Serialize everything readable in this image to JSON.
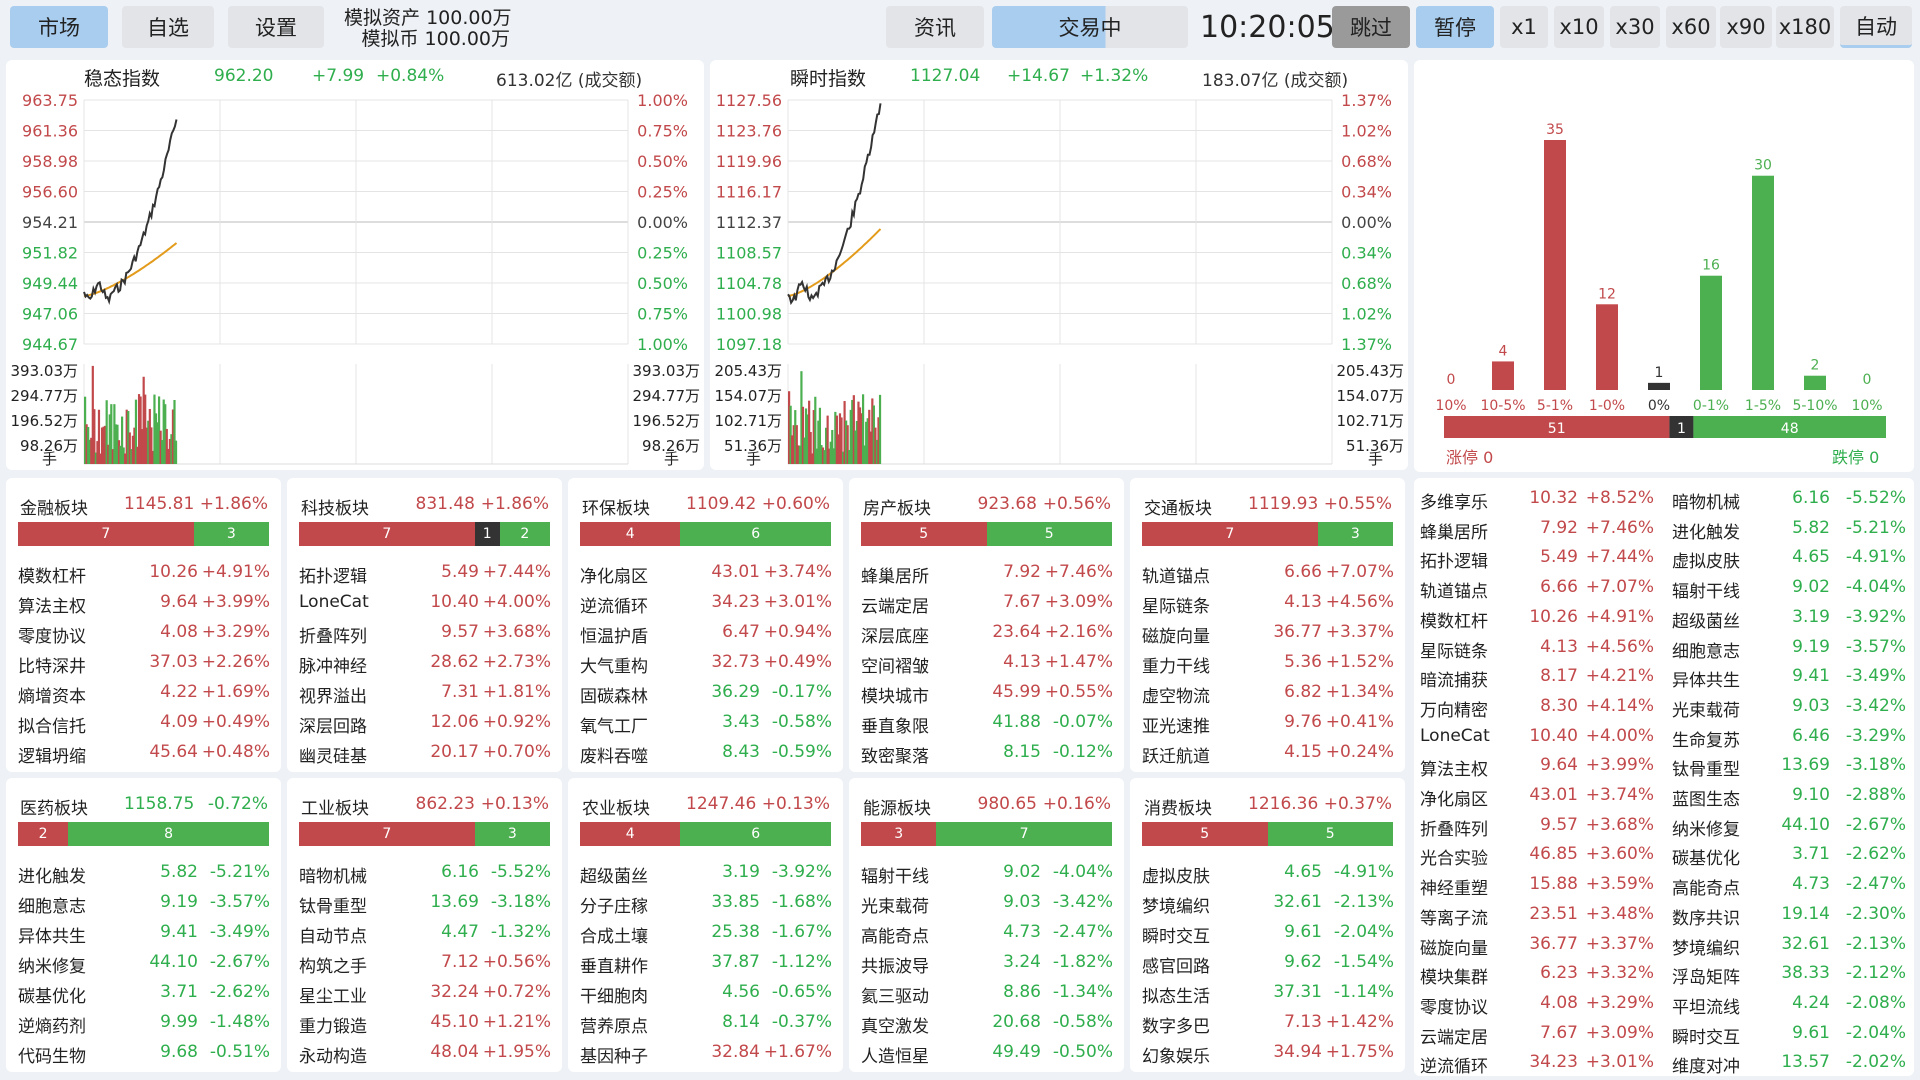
{
  "top": {
    "tabs": [
      {
        "label": "市场",
        "active": true
      },
      {
        "label": "自选"
      },
      {
        "label": "设置"
      }
    ],
    "asset_label": "模拟资产",
    "asset_value": "100.00万",
    "coin_label": "模拟币",
    "coin_value": "100.00万",
    "news": "资讯",
    "status": "交易中",
    "clock": "10:20:05",
    "skip": "跳过",
    "pause": "暂停",
    "speeds": [
      "x1",
      "x10",
      "x30",
      "x60",
      "x90",
      "x180"
    ],
    "auto": "自动"
  },
  "indices": [
    {
      "name": "稳态指数",
      "value": "962.20",
      "change": "+7.99",
      "pct": "+0.84%",
      "amount": "613.02亿 (成交额)",
      "left_ticks": [
        "963.75",
        "961.36",
        "958.98",
        "956.60",
        "954.21",
        "951.82",
        "949.44",
        "947.06",
        "944.67"
      ],
      "right_ticks": [
        "1.00%",
        "0.75%",
        "0.50%",
        "0.25%",
        "0.00%",
        "0.25%",
        "0.50%",
        "0.75%",
        "1.00%"
      ],
      "vol_ticks": [
        "393.03万",
        "294.77万",
        "196.52万",
        "98.26万"
      ],
      "unit": "手"
    },
    {
      "name": "瞬时指数",
      "value": "1127.04",
      "change": "+14.67",
      "pct": "+1.32%",
      "amount": "183.07亿 (成交额)",
      "left_ticks": [
        "1127.56",
        "1123.76",
        "1119.96",
        "1116.17",
        "1112.37",
        "1108.57",
        "1104.78",
        "1100.98",
        "1097.18"
      ],
      "right_ticks": [
        "1.37%",
        "1.02%",
        "0.68%",
        "0.34%",
        "0.00%",
        "0.34%",
        "0.68%",
        "1.02%",
        "1.37%"
      ],
      "vol_ticks": [
        "205.43万",
        "154.07万",
        "102.71万",
        "51.36万"
      ],
      "unit": "手"
    }
  ],
  "chart_data": {
    "type": "bar",
    "categories": [
      "10%",
      "10-5%",
      "5-1%",
      "1-0%",
      "0%",
      "0-1%",
      "1-5%",
      "5-10%",
      "10%"
    ],
    "values": [
      0,
      4,
      35,
      12,
      1,
      16,
      30,
      2,
      0
    ],
    "colors": [
      "#c2494b",
      "#c2494b",
      "#c2494b",
      "#c2494b",
      "#333333",
      "#4caf50",
      "#4caf50",
      "#4caf50",
      "#4caf50"
    ],
    "ratio": {
      "up": 51,
      "flat": 1,
      "down": 48
    },
    "limit_up": "涨停 0",
    "limit_down": "跌停 0"
  },
  "sectors": [
    {
      "name": "金融板块",
      "value": "1145.81",
      "pct": "+1.86%",
      "up": 7,
      "flat": 0,
      "down": 3,
      "stocks": [
        [
          "模数杠杆",
          "10.26",
          "+4.91%"
        ],
        [
          "算法主权",
          "9.64",
          "+3.99%"
        ],
        [
          "零度协议",
          "4.08",
          "+3.29%"
        ],
        [
          "比特深井",
          "37.03",
          "+2.26%"
        ],
        [
          "熵增资本",
          "4.22",
          "+1.69%"
        ],
        [
          "拟合信托",
          "4.09",
          "+0.49%"
        ],
        [
          "逻辑坍缩",
          "45.64",
          "+0.48%"
        ]
      ]
    },
    {
      "name": "科技板块",
      "value": "831.48",
      "pct": "+1.86%",
      "up": 7,
      "flat": 1,
      "down": 2,
      "stocks": [
        [
          "拓扑逻辑",
          "5.49",
          "+7.44%"
        ],
        [
          "LoneCat",
          "10.40",
          "+4.00%"
        ],
        [
          "折叠阵列",
          "9.57",
          "+3.68%"
        ],
        [
          "脉冲神经",
          "28.62",
          "+2.73%"
        ],
        [
          "视界溢出",
          "7.31",
          "+1.81%"
        ],
        [
          "深层回路",
          "12.06",
          "+0.92%"
        ],
        [
          "幽灵硅基",
          "20.17",
          "+0.70%"
        ]
      ]
    },
    {
      "name": "环保板块",
      "value": "1109.42",
      "pct": "+0.60%",
      "up": 4,
      "flat": 0,
      "down": 6,
      "stocks": [
        [
          "净化扇区",
          "43.01",
          "+3.74%"
        ],
        [
          "逆流循环",
          "34.23",
          "+3.01%"
        ],
        [
          "恒温护盾",
          "6.47",
          "+0.94%"
        ],
        [
          "大气重构",
          "32.73",
          "+0.49%"
        ],
        [
          "固碳森林",
          "36.29",
          "-0.17%"
        ],
        [
          "氧气工厂",
          "3.43",
          "-0.58%"
        ],
        [
          "废料吞噬",
          "8.43",
          "-0.59%"
        ]
      ]
    },
    {
      "name": "房产板块",
      "value": "923.68",
      "pct": "+0.56%",
      "up": 5,
      "flat": 0,
      "down": 5,
      "stocks": [
        [
          "蜂巢居所",
          "7.92",
          "+7.46%"
        ],
        [
          "云端定居",
          "7.67",
          "+3.09%"
        ],
        [
          "深层底座",
          "23.64",
          "+2.16%"
        ],
        [
          "空间褶皱",
          "4.13",
          "+1.47%"
        ],
        [
          "模块城市",
          "45.99",
          "+0.55%"
        ],
        [
          "垂直象限",
          "41.88",
          "-0.07%"
        ],
        [
          "致密聚落",
          "8.15",
          "-0.12%"
        ]
      ]
    },
    {
      "name": "交通板块",
      "value": "1119.93",
      "pct": "+0.55%",
      "up": 7,
      "flat": 0,
      "down": 3,
      "stocks": [
        [
          "轨道锚点",
          "6.66",
          "+7.07%"
        ],
        [
          "星际链条",
          "4.13",
          "+4.56%"
        ],
        [
          "磁旋向量",
          "36.77",
          "+3.37%"
        ],
        [
          "重力干线",
          "5.36",
          "+1.52%"
        ],
        [
          "虚空物流",
          "6.82",
          "+1.34%"
        ],
        [
          "亚光速推",
          "9.76",
          "+0.41%"
        ],
        [
          "跃迁航道",
          "4.15",
          "+0.24%"
        ]
      ]
    },
    {
      "name": "医药板块",
      "value": "1158.75",
      "pct": "-0.72%",
      "up": 2,
      "flat": 0,
      "down": 8,
      "stocks": [
        [
          "进化触发",
          "5.82",
          "-5.21%"
        ],
        [
          "细胞意志",
          "9.19",
          "-3.57%"
        ],
        [
          "异体共生",
          "9.41",
          "-3.49%"
        ],
        [
          "纳米修复",
          "44.10",
          "-2.67%"
        ],
        [
          "碳基优化",
          "3.71",
          "-2.62%"
        ],
        [
          "逆熵药剂",
          "9.99",
          "-1.48%"
        ],
        [
          "代码生物",
          "9.68",
          "-0.51%"
        ]
      ]
    },
    {
      "name": "工业板块",
      "value": "862.23",
      "pct": "+0.13%",
      "up": 7,
      "flat": 0,
      "down": 3,
      "stocks": [
        [
          "暗物机械",
          "6.16",
          "-5.52%"
        ],
        [
          "钛骨重型",
          "13.69",
          "-3.18%"
        ],
        [
          "自动节点",
          "4.47",
          "-1.32%"
        ],
        [
          "构筑之手",
          "7.12",
          "+0.56%"
        ],
        [
          "星尘工业",
          "32.24",
          "+0.72%"
        ],
        [
          "重力锻造",
          "45.10",
          "+1.21%"
        ],
        [
          "永动构造",
          "48.04",
          "+1.95%"
        ]
      ]
    },
    {
      "name": "农业板块",
      "value": "1247.46",
      "pct": "+0.13%",
      "up": 4,
      "flat": 0,
      "down": 6,
      "stocks": [
        [
          "超级菌丝",
          "3.19",
          "-3.92%"
        ],
        [
          "分子庄稼",
          "33.85",
          "-1.68%"
        ],
        [
          "合成土壤",
          "25.38",
          "-1.67%"
        ],
        [
          "垂直耕作",
          "37.87",
          "-1.12%"
        ],
        [
          "干细胞肉",
          "4.56",
          "-0.65%"
        ],
        [
          "营养原点",
          "8.14",
          "-0.37%"
        ],
        [
          "基因种子",
          "32.84",
          "+1.67%"
        ]
      ]
    },
    {
      "name": "能源板块",
      "value": "980.65",
      "pct": "+0.16%",
      "up": 3,
      "flat": 0,
      "down": 7,
      "stocks": [
        [
          "辐射干线",
          "9.02",
          "-4.04%"
        ],
        [
          "光束载荷",
          "9.03",
          "-3.42%"
        ],
        [
          "高能奇点",
          "4.73",
          "-2.47%"
        ],
        [
          "共振波导",
          "3.24",
          "-1.82%"
        ],
        [
          "氦三驱动",
          "8.86",
          "-1.34%"
        ],
        [
          "真空激发",
          "20.68",
          "-0.58%"
        ],
        [
          "人造恒星",
          "49.49",
          "-0.50%"
        ]
      ]
    },
    {
      "name": "消费板块",
      "value": "1216.36",
      "pct": "+0.37%",
      "up": 5,
      "flat": 0,
      "down": 5,
      "stocks": [
        [
          "虚拟皮肤",
          "4.65",
          "-4.91%"
        ],
        [
          "梦境编织",
          "32.61",
          "-2.13%"
        ],
        [
          "瞬时交互",
          "9.61",
          "-2.04%"
        ],
        [
          "感官回路",
          "9.62",
          "-1.54%"
        ],
        [
          "拟态生活",
          "37.31",
          "-1.14%"
        ],
        [
          "数字多巴",
          "7.13",
          "+1.42%"
        ],
        [
          "幻象娱乐",
          "34.94",
          "+1.75%"
        ]
      ]
    }
  ],
  "gainers": [
    [
      "多维享乐",
      "10.32",
      "+8.52%"
    ],
    [
      "蜂巢居所",
      "7.92",
      "+7.46%"
    ],
    [
      "拓扑逻辑",
      "5.49",
      "+7.44%"
    ],
    [
      "轨道锚点",
      "6.66",
      "+7.07%"
    ],
    [
      "模数杠杆",
      "10.26",
      "+4.91%"
    ],
    [
      "星际链条",
      "4.13",
      "+4.56%"
    ],
    [
      "暗流捕获",
      "8.17",
      "+4.21%"
    ],
    [
      "万向精密",
      "8.30",
      "+4.14%"
    ],
    [
      "LoneCat",
      "10.40",
      "+4.00%"
    ],
    [
      "算法主权",
      "9.64",
      "+3.99%"
    ],
    [
      "净化扇区",
      "43.01",
      "+3.74%"
    ],
    [
      "折叠阵列",
      "9.57",
      "+3.68%"
    ],
    [
      "光合实验",
      "46.85",
      "+3.60%"
    ],
    [
      "神经重塑",
      "15.88",
      "+3.59%"
    ],
    [
      "等离子流",
      "23.51",
      "+3.48%"
    ],
    [
      "磁旋向量",
      "36.77",
      "+3.37%"
    ],
    [
      "模块集群",
      "6.23",
      "+3.32%"
    ],
    [
      "零度协议",
      "4.08",
      "+3.29%"
    ],
    [
      "云端定居",
      "7.67",
      "+3.09%"
    ],
    [
      "逆流循环",
      "34.23",
      "+3.01%"
    ]
  ],
  "losers": [
    [
      "暗物机械",
      "6.16",
      "-5.52%"
    ],
    [
      "进化触发",
      "5.82",
      "-5.21%"
    ],
    [
      "虚拟皮肤",
      "4.65",
      "-4.91%"
    ],
    [
      "辐射干线",
      "9.02",
      "-4.04%"
    ],
    [
      "超级菌丝",
      "3.19",
      "-3.92%"
    ],
    [
      "细胞意志",
      "9.19",
      "-3.57%"
    ],
    [
      "异体共生",
      "9.41",
      "-3.49%"
    ],
    [
      "光束载荷",
      "9.03",
      "-3.42%"
    ],
    [
      "生命复苏",
      "6.46",
      "-3.29%"
    ],
    [
      "钛骨重型",
      "13.69",
      "-3.18%"
    ],
    [
      "蓝图生态",
      "9.10",
      "-2.88%"
    ],
    [
      "纳米修复",
      "44.10",
      "-2.67%"
    ],
    [
      "碳基优化",
      "3.71",
      "-2.62%"
    ],
    [
      "高能奇点",
      "4.73",
      "-2.47%"
    ],
    [
      "数序共识",
      "19.14",
      "-2.30%"
    ],
    [
      "梦境编织",
      "32.61",
      "-2.13%"
    ],
    [
      "浮岛矩阵",
      "38.33",
      "-2.12%"
    ],
    [
      "平坦流线",
      "4.24",
      "-2.08%"
    ],
    [
      "瞬时交互",
      "9.61",
      "-2.04%"
    ],
    [
      "维度对冲",
      "13.57",
      "-2.02%"
    ]
  ]
}
